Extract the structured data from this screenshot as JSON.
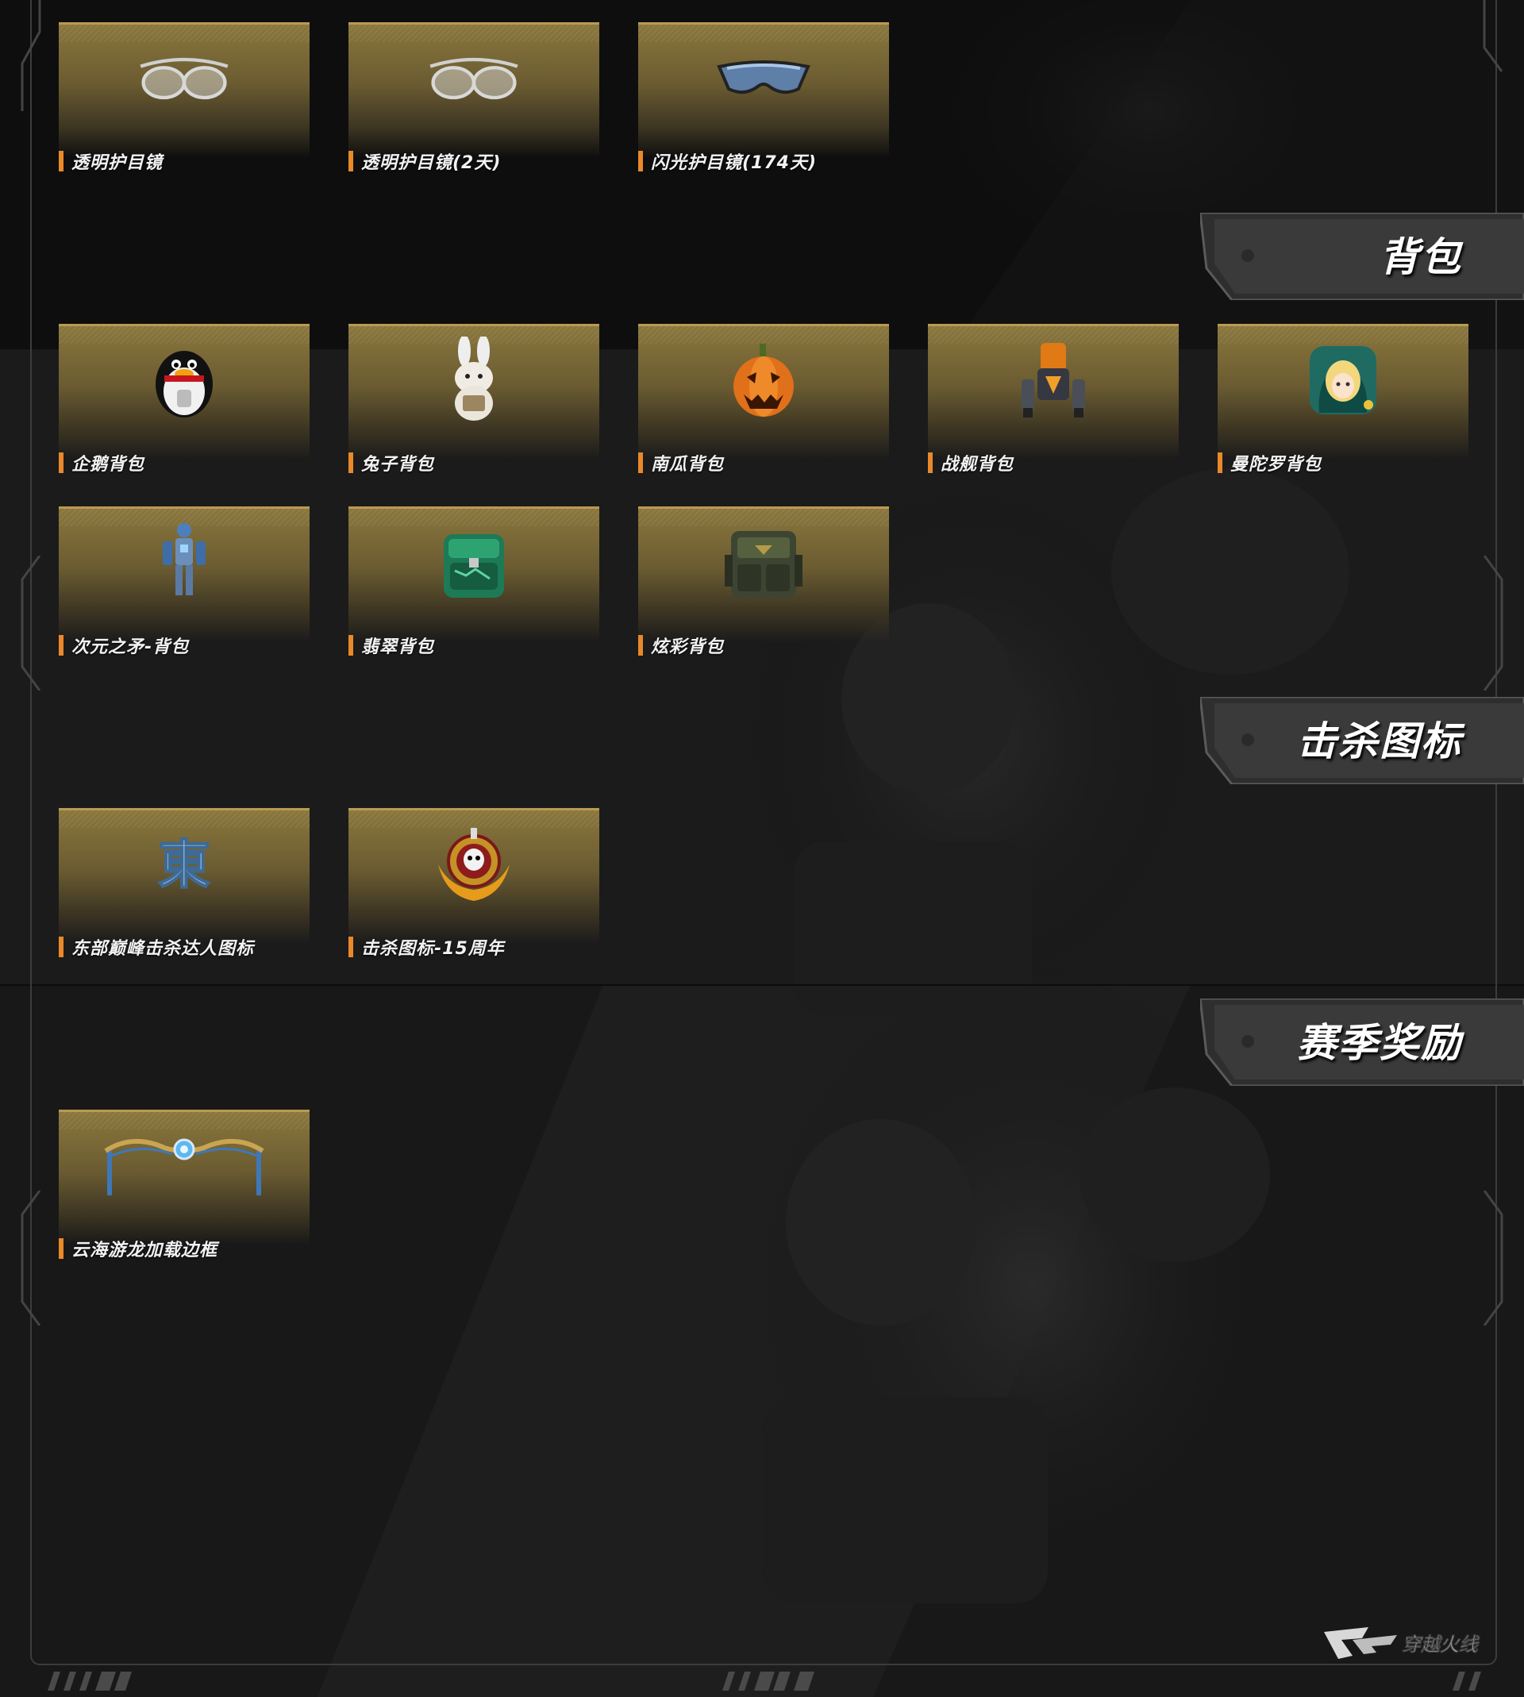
{
  "sections": {
    "goggles": {
      "items": [
        {
          "label": "透明护目镜",
          "icon": "clear-goggles-icon"
        },
        {
          "label": "透明护目镜(2天)",
          "icon": "clear-goggles-icon"
        },
        {
          "label": "闪光护目镜(174天)",
          "icon": "flash-goggles-icon"
        }
      ]
    },
    "backpack": {
      "title": "背包",
      "items": [
        {
          "label": "企鹅背包",
          "icon": "penguin-backpack-icon"
        },
        {
          "label": "兔子背包",
          "icon": "rabbit-backpack-icon"
        },
        {
          "label": "南瓜背包",
          "icon": "pumpkin-backpack-icon"
        },
        {
          "label": "战舰背包",
          "icon": "warship-backpack-icon"
        },
        {
          "label": "曼陀罗背包",
          "icon": "mandala-backpack-icon"
        },
        {
          "label": "次元之矛-背包",
          "icon": "dimension-spear-backpack-icon"
        },
        {
          "label": "翡翠背包",
          "icon": "jade-backpack-icon"
        },
        {
          "label": "炫彩背包",
          "icon": "colorful-backpack-icon"
        }
      ]
    },
    "kill_icon": {
      "title": "击杀图标",
      "items": [
        {
          "label": "东部巅峰击杀达人图标",
          "icon": "east-kill-icon"
        },
        {
          "label": "击杀图标-15周年",
          "icon": "anniversary-kill-icon"
        }
      ]
    },
    "season_reward": {
      "title": "赛季奖励",
      "items": [
        {
          "label": "云海游龙加载边框",
          "icon": "dragon-loading-frame-icon"
        }
      ]
    }
  },
  "logo": {
    "text": "穿越火线",
    "mark": "CF"
  },
  "colors": {
    "accent": "#e8892a",
    "card_gold": "#8a773d",
    "background": "#141414"
  }
}
